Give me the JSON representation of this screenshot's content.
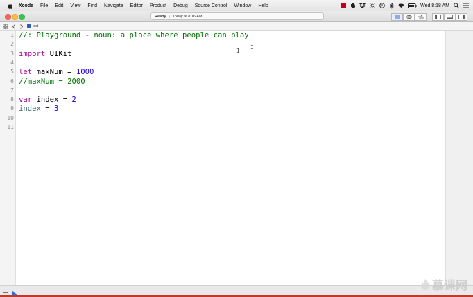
{
  "menubar": {
    "app_name": "Xcode",
    "items": [
      "File",
      "Edit",
      "View",
      "Find",
      "Navigate",
      "Editor",
      "Product",
      "Debug",
      "Source Control",
      "Window",
      "Help"
    ],
    "clock": "Wed 8:18 AM",
    "tray_icons": [
      "record-icon",
      "evernote-icon",
      "dropbox-icon",
      "sync-icon",
      "clock-icon",
      "bluetooth-icon",
      "wifi-icon",
      "battery-icon",
      "search-icon",
      "list-icon"
    ]
  },
  "toolbar": {
    "status_ready": "Ready",
    "status_separator": "|",
    "status_time": "Today at 8:16 AM"
  },
  "jumpbar": {
    "file_name": "test"
  },
  "editor": {
    "line_numbers": [
      "1",
      "2",
      "3",
      "4",
      "5",
      "6",
      "7",
      "8",
      "9",
      "10",
      "11"
    ],
    "lines": [
      {
        "parts": [
          {
            "text": "//: Playground - noun: a place where people can play",
            "kind": "cm"
          }
        ]
      },
      {
        "parts": []
      },
      {
        "parts": [
          {
            "text": "import",
            "kind": "kw"
          },
          {
            "text": " UIKit",
            "kind": "ty"
          }
        ]
      },
      {
        "parts": []
      },
      {
        "parts": [
          {
            "text": "let",
            "kind": "kw"
          },
          {
            "text": " maxNum = ",
            "kind": "ty"
          },
          {
            "text": "1000",
            "kind": "num"
          }
        ]
      },
      {
        "parts": [
          {
            "text": "//maxNum = 2000",
            "kind": "cm"
          }
        ]
      },
      {
        "parts": []
      },
      {
        "parts": [
          {
            "text": "var",
            "kind": "kw"
          },
          {
            "text": " index = ",
            "kind": "ty"
          },
          {
            "text": "2",
            "kind": "num"
          }
        ]
      },
      {
        "parts": [
          {
            "text": "index",
            "kind": "var"
          },
          {
            "text": " = ",
            "kind": "ty"
          },
          {
            "text": "3",
            "kind": "num"
          }
        ]
      },
      {
        "parts": []
      },
      {
        "parts": []
      }
    ]
  },
  "watermark": {
    "text": "慕课网"
  },
  "colors": {
    "keyword": "#aa0d91",
    "comment": "#007400",
    "number": "#1c00cf",
    "variable": "#3f6e74"
  }
}
